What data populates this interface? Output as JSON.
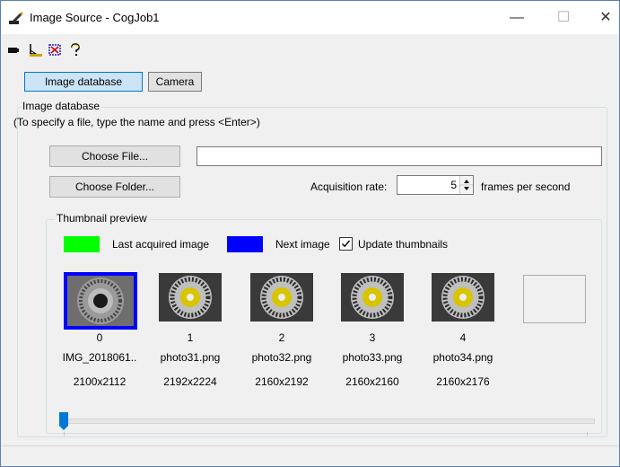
{
  "window": {
    "title": "Image Source - CogJob1",
    "minimize_glyph": "—",
    "maximize_glyph": "☐",
    "close_glyph": "✕"
  },
  "tabs": [
    {
      "label": "Image database",
      "active": true
    },
    {
      "label": "Camera",
      "active": false
    }
  ],
  "group": {
    "label": "Image database",
    "hint": "(To specify a file, type the name and press <Enter>)"
  },
  "choose_file": {
    "label": "Choose File...",
    "value": ""
  },
  "choose_folder": {
    "label": "Choose Folder..."
  },
  "acquisition": {
    "label": "Acquisition rate:",
    "value": "5",
    "unit": "frames per second"
  },
  "thumbnail": {
    "label": "Thumbnail preview",
    "legend_last": "Last acquired image",
    "legend_next": "Next image",
    "update_label": "Update thumbnails",
    "update_checked": true,
    "colors": {
      "last": "#00ff00",
      "next": "#0000ff"
    },
    "items": [
      {
        "index": "0",
        "name": "IMG_2018061..",
        "size": "2100x2112"
      },
      {
        "index": "1",
        "name": "photo31.png",
        "size": "2192x2224"
      },
      {
        "index": "2",
        "name": "photo32.png",
        "size": "2160x2192"
      },
      {
        "index": "3",
        "name": "photo33.png",
        "size": "2160x2160"
      },
      {
        "index": "4",
        "name": "photo34.png",
        "size": "2160x2176"
      }
    ],
    "slider_position": 0
  }
}
